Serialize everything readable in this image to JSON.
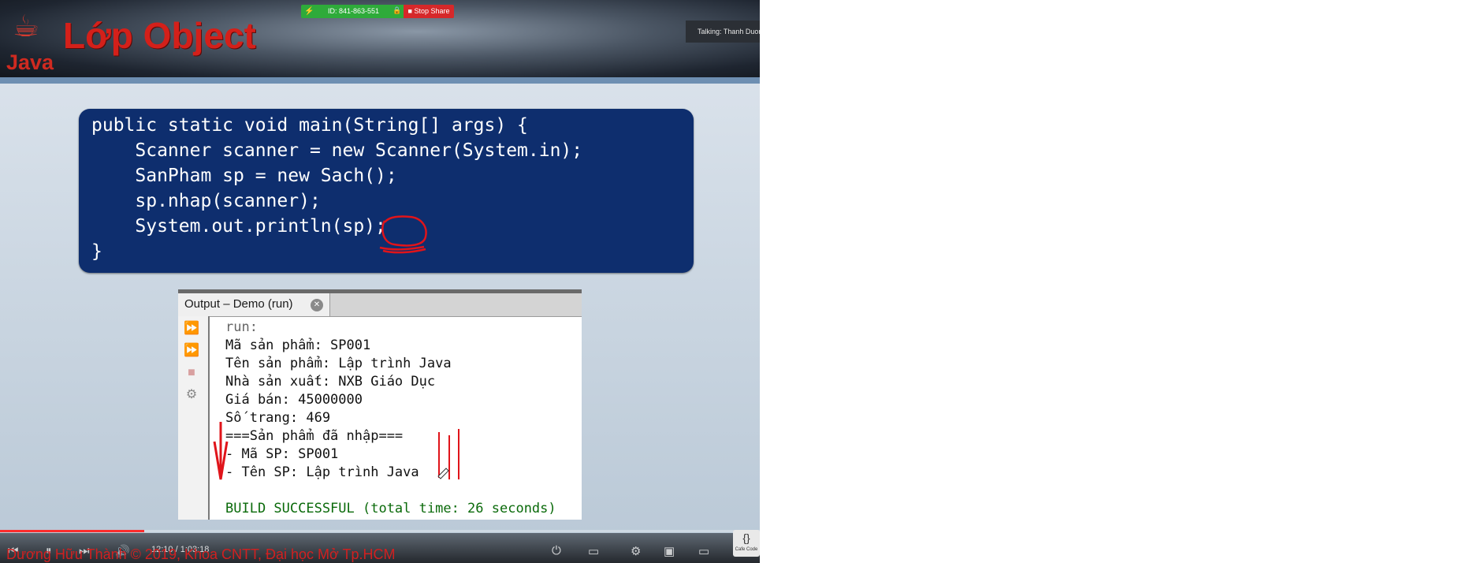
{
  "header": {
    "logo_text": "Java",
    "title": "Lớp Object"
  },
  "share_bar": {
    "meeting_id": "ID: 841-863-551",
    "stop_label": "Stop Share",
    "talking": "Talking: Thanh Duon"
  },
  "code": {
    "lines": [
      "public static void main(String[] args) {",
      "    Scanner scanner = new Scanner(System.in);",
      "    SanPham sp = new Sach();",
      "    sp.nhap(scanner);",
      "    System.out.println(sp);",
      "}"
    ]
  },
  "output": {
    "tab_label": "Output – Demo (run)",
    "lines": [
      "run:",
      "Mã sản phẩm: SP001",
      "Tên sản phẩm: Lập trình Java",
      "Nhà sản xuất: NXB Giáo Dục",
      "Giá bán: 45000000",
      "Số trang: 469",
      "===Sản phẩm đã nhập===",
      "- Mã SP: SP001",
      "- Tên SP: Lập trình Java",
      "",
      "BUILD SUCCESSFUL (total time: 26 seconds)"
    ]
  },
  "player": {
    "time": "12:10 / 1:03:18",
    "progress": 0.19,
    "caption": "Dương Hữu Thành © 2019, Khoa CNTT, Đại học Mở Tp.HCM",
    "channel_badge": "Cafe Code"
  },
  "colors": {
    "title_red": "#d4201a",
    "code_bg": "#0e2e6e",
    "share_green": "#2eab3a",
    "stop_red": "#d6282a",
    "build_green": "#0a6a0a",
    "annotation_red": "#e0141a"
  }
}
